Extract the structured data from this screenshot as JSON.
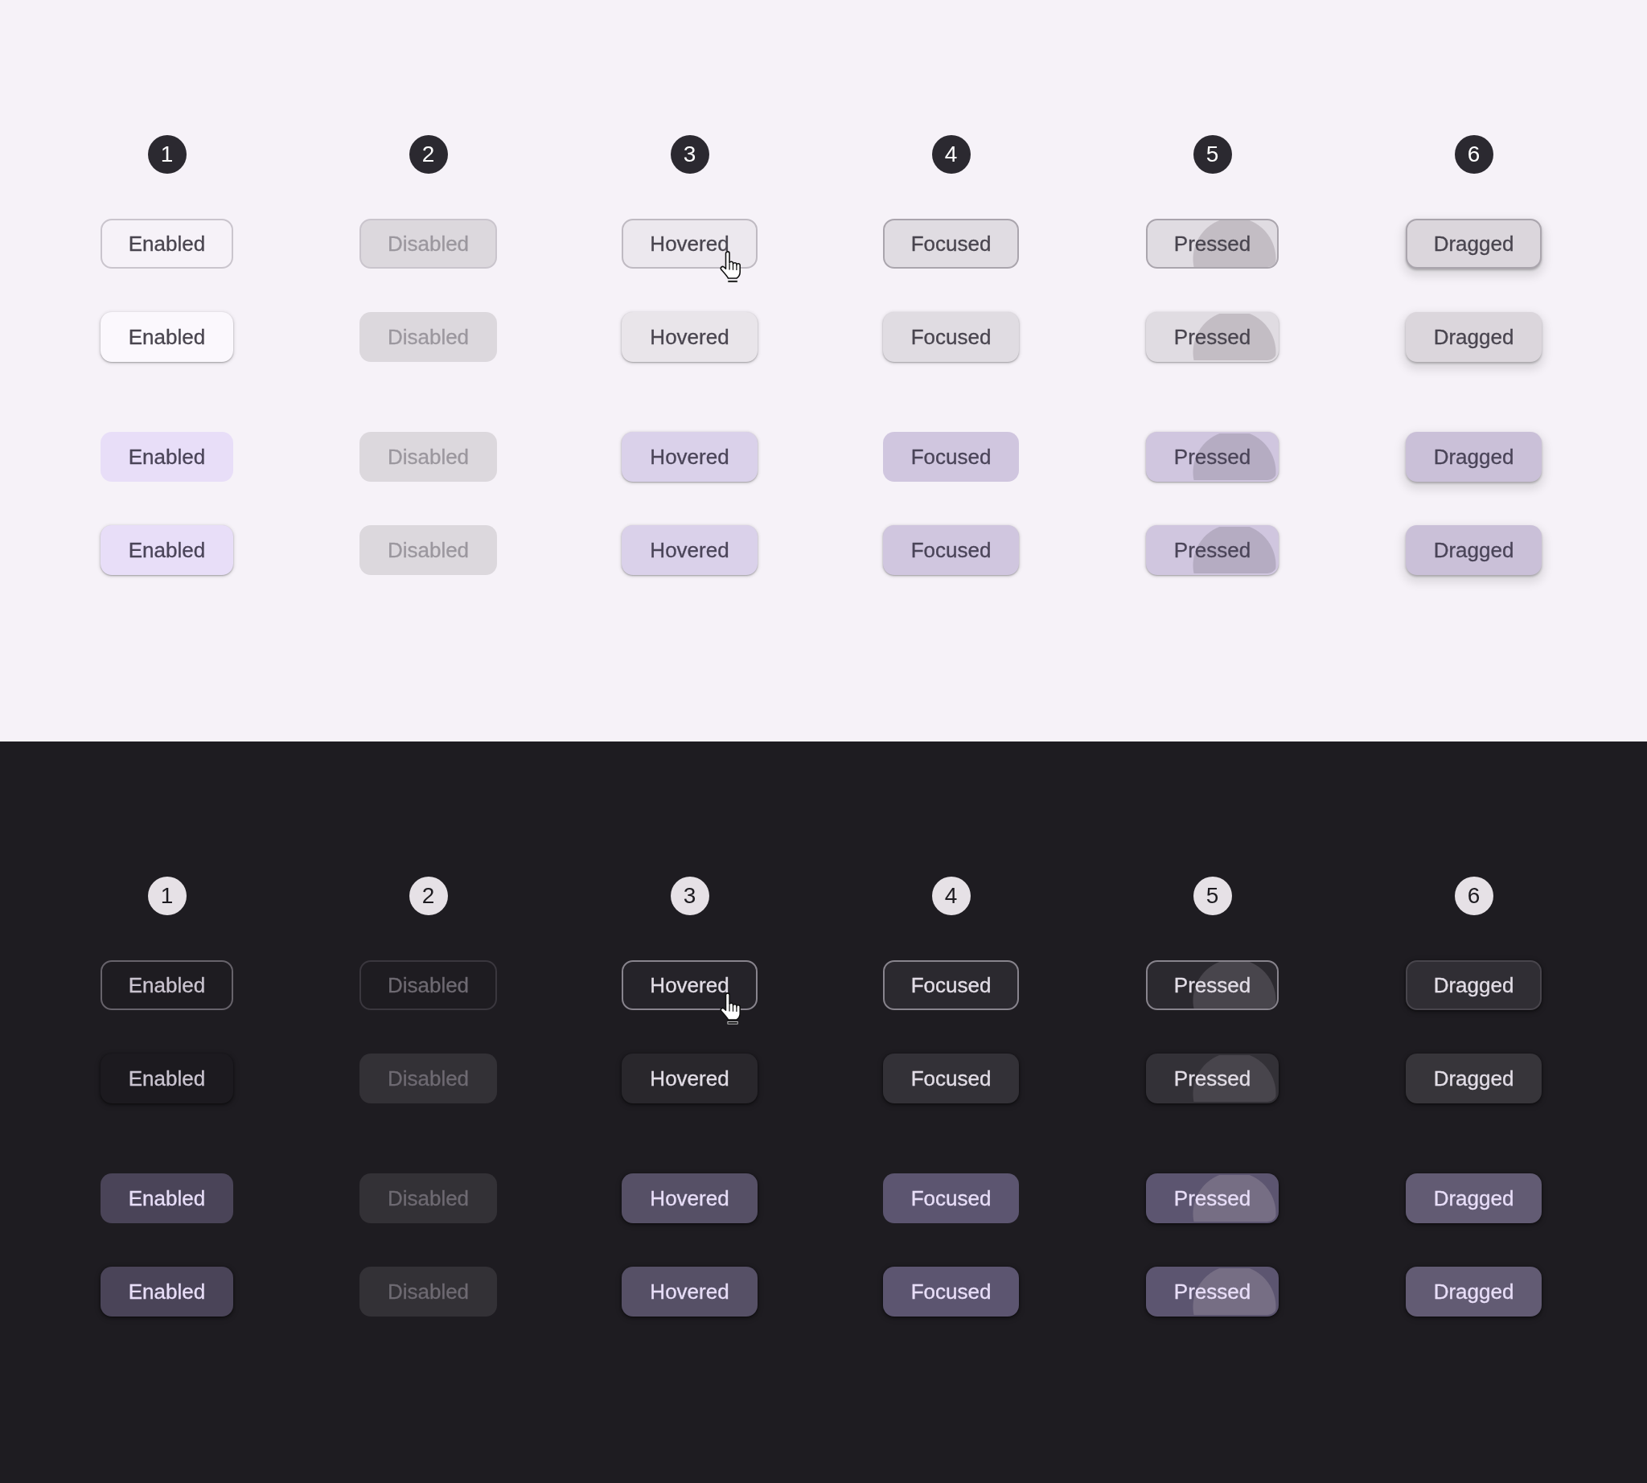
{
  "panels": [
    {
      "dark": false,
      "badges": [
        "1",
        "2",
        "3",
        "4",
        "5",
        "6"
      ],
      "rows": [
        {
          "kind": "outlined",
          "chips": [
            {
              "label": "Enabled",
              "kind": "enabled",
              "selected": false
            },
            {
              "label": "Disabled",
              "kind": "disabled",
              "selected": false
            },
            {
              "label": "Hovered",
              "kind": "hovered",
              "selected": false,
              "pointer": true
            },
            {
              "label": "Focused",
              "kind": "focused",
              "selected": false
            },
            {
              "label": "Pressed",
              "kind": "pressed",
              "selected": false
            },
            {
              "label": "Dragged",
              "kind": "dragged",
              "selected": false
            }
          ]
        },
        {
          "kind": "elevated",
          "chips": [
            {
              "label": "Enabled",
              "kind": "enabled",
              "selected": false
            },
            {
              "label": "Disabled",
              "kind": "disabled"
            },
            {
              "label": "Hovered",
              "kind": "hovered",
              "selected": false
            },
            {
              "label": "Focused",
              "kind": "focused",
              "selected": false
            },
            {
              "label": "Pressed",
              "kind": "pressed",
              "selected": false
            },
            {
              "label": "Dragged",
              "kind": "dragged",
              "selected": false
            }
          ]
        },
        {
          "kind": "outlined",
          "chips": [
            {
              "label": "Enabled",
              "kind": "enabled",
              "selected": true
            },
            {
              "label": "Disabled",
              "kind": "disabled",
              "selected": true
            },
            {
              "label": "Hovered",
              "kind": "hovered",
              "selected": true
            },
            {
              "label": "Focused",
              "kind": "focused",
              "selected": true
            },
            {
              "label": "Pressed",
              "kind": "pressed",
              "selected": true
            },
            {
              "label": "Dragged",
              "kind": "dragged",
              "selected": true
            }
          ]
        },
        {
          "kind": "elevated",
          "chips": [
            {
              "label": "Enabled",
              "kind": "enabled",
              "selected": true
            },
            {
              "label": "Disabled",
              "kind": "disabled"
            },
            {
              "label": "Hovered",
              "kind": "hovered",
              "selected": true
            },
            {
              "label": "Focused",
              "kind": "focused",
              "selected": true
            },
            {
              "label": "Pressed",
              "kind": "pressed",
              "selected": true
            },
            {
              "label": "Dragged",
              "kind": "dragged",
              "selected": true
            }
          ]
        }
      ]
    },
    {
      "dark": true,
      "badges": [
        "1",
        "2",
        "3",
        "4",
        "5",
        "6"
      ],
      "rows": [
        {
          "kind": "outlined",
          "chips": [
            {
              "label": "Enabled",
              "kind": "enabled",
              "selected": false
            },
            {
              "label": "Disabled",
              "kind": "disabled",
              "selected": false
            },
            {
              "label": "Hovered",
              "kind": "hovered",
              "selected": false,
              "pointer": true
            },
            {
              "label": "Focused",
              "kind": "focused",
              "selected": false
            },
            {
              "label": "Pressed",
              "kind": "pressed",
              "selected": false
            },
            {
              "label": "Dragged",
              "kind": "dragged",
              "selected": false
            }
          ]
        },
        {
          "kind": "elevated",
          "chips": [
            {
              "label": "Enabled",
              "kind": "enabled",
              "selected": false
            },
            {
              "label": "Disabled",
              "kind": "disabled"
            },
            {
              "label": "Hovered",
              "kind": "hovered",
              "selected": false
            },
            {
              "label": "Focused",
              "kind": "focused",
              "selected": false
            },
            {
              "label": "Pressed",
              "kind": "pressed",
              "selected": false
            },
            {
              "label": "Dragged",
              "kind": "dragged",
              "selected": false
            }
          ]
        },
        {
          "kind": "outlined",
          "chips": [
            {
              "label": "Enabled",
              "kind": "enabled",
              "selected": true
            },
            {
              "label": "Disabled",
              "kind": "disabled",
              "selected": true
            },
            {
              "label": "Hovered",
              "kind": "hovered",
              "selected": true
            },
            {
              "label": "Focused",
              "kind": "focused",
              "selected": true
            },
            {
              "label": "Pressed",
              "kind": "pressed",
              "selected": true
            },
            {
              "label": "Dragged",
              "kind": "dragged",
              "selected": true
            }
          ]
        },
        {
          "kind": "elevated",
          "chips": [
            {
              "label": "Enabled",
              "kind": "enabled",
              "selected": true
            },
            {
              "label": "Disabled",
              "kind": "disabled"
            },
            {
              "label": "Hovered",
              "kind": "hovered",
              "selected": true
            },
            {
              "label": "Focused",
              "kind": "focused",
              "selected": true
            },
            {
              "label": "Pressed",
              "kind": "pressed",
              "selected": true
            },
            {
              "label": "Dragged",
              "kind": "dragged",
              "selected": true
            }
          ]
        }
      ]
    }
  ]
}
